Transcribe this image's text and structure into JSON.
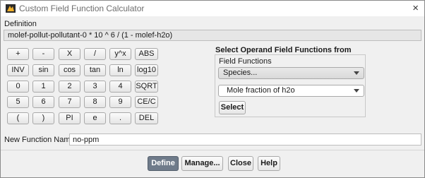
{
  "window": {
    "title": "Custom Field Function Calculator",
    "close_glyph": "×"
  },
  "definition": {
    "label": "Definition",
    "value": "molef-pollut-pollutant-0 * 10 ^ 6 / (1 - molef-h2o)"
  },
  "keypad": {
    "rows": [
      [
        "+",
        "-",
        "X",
        "/",
        "y^x",
        "ABS"
      ],
      [
        "INV",
        "sin",
        "cos",
        "tan",
        "ln",
        "log10"
      ],
      [
        "0",
        "1",
        "2",
        "3",
        "4",
        "SQRT"
      ],
      [
        "5",
        "6",
        "7",
        "8",
        "9",
        "CE/C"
      ],
      [
        "(",
        ")",
        "PI",
        "e",
        ".",
        "DEL"
      ]
    ]
  },
  "operand": {
    "header": "Select Operand Field Functions from",
    "field_functions_label": "Field Functions",
    "category_value": "Species...",
    "quantity_value": "Mole fraction of h2o",
    "select_label": "Select"
  },
  "new_function": {
    "label": "New Function Name",
    "value": "no-ppm"
  },
  "actions": {
    "define": "Define",
    "manage": "Manage...",
    "close": "Close",
    "help": "Help"
  },
  "colors": {
    "primary_button": "#6f7b8a",
    "window_bg": "#f0f0f0"
  }
}
